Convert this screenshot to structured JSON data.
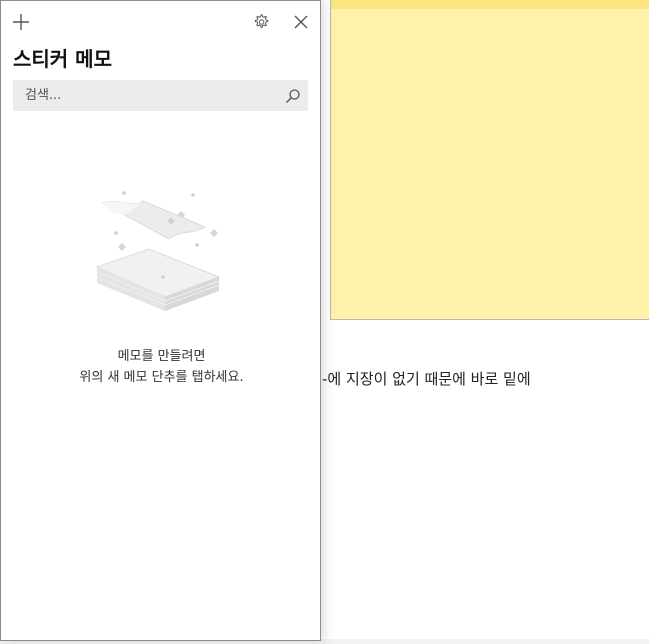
{
  "panel": {
    "title": "스티커 메모",
    "search_placeholder": "검색...",
    "empty_line1": "메모를 만들려면",
    "empty_line2": "위의 새 메모 단추를 탭하세요.",
    "icons": {
      "add": "plus-icon",
      "settings": "gear-icon",
      "close": "close-icon",
      "search": "search-icon",
      "illustration": "empty-notes-illustration"
    }
  },
  "background": {
    "text": "-에 지장이 없기 때문에 바로 밑에"
  },
  "colors": {
    "note_body": "#fef1a8",
    "note_header": "#fde680",
    "search_bg": "#ececec"
  }
}
